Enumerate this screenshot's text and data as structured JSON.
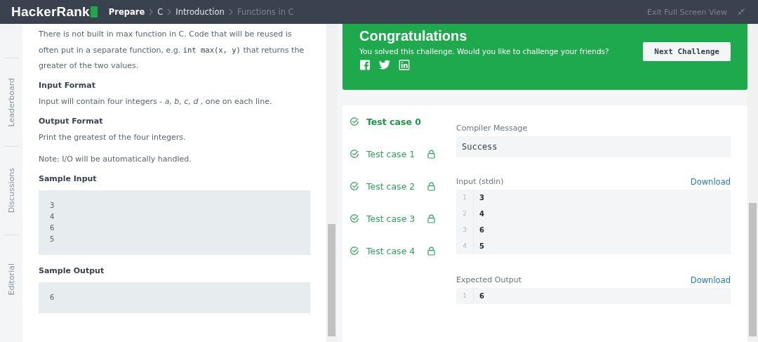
{
  "header": {
    "logo": "HackerRank",
    "breadcrumbs": [
      {
        "label": "Prepare",
        "current": false
      },
      {
        "label": "C",
        "current": false
      },
      {
        "label": "Introduction",
        "current": false
      },
      {
        "label": "Functions in C",
        "current": true
      }
    ],
    "exit_link": "Exit Full Screen View"
  },
  "side_tabs": [
    "Leaderboard",
    "Discussions",
    "Editorial"
  ],
  "problem": {
    "intro": [
      {
        "kind": "text",
        "text": "There is not built in max function in C. Code that will be reused is often put in a separate function, e.g. "
      },
      {
        "kind": "code",
        "text": "int max(x, y)"
      },
      {
        "kind": "text",
        "text": " that returns the greater of the two values."
      }
    ],
    "sections": [
      {
        "heading": "Input Format",
        "lines": [
          "Input will contain four integers - *a, b, c, d* , one on each line."
        ]
      },
      {
        "heading": "Output Format",
        "lines": [
          "Print the greatest of the four integers.",
          "Note: I/O will be automatically handled."
        ]
      },
      {
        "heading": "Sample Input",
        "code": [
          "3",
          "4",
          "6",
          "5"
        ]
      },
      {
        "heading": "Sample Output",
        "code": [
          "6"
        ]
      }
    ]
  },
  "banner": {
    "title": "Congratulations",
    "message": "You solved this challenge. Would you like to challenge your friends?",
    "button": "Next Challenge"
  },
  "test_cases": [
    {
      "label": "Test case 0",
      "selected": true,
      "locked": false
    },
    {
      "label": "Test case 1",
      "selected": false,
      "locked": true
    },
    {
      "label": "Test case 2",
      "selected": false,
      "locked": true
    },
    {
      "label": "Test case 3",
      "selected": false,
      "locked": true
    },
    {
      "label": "Test case 4",
      "selected": false,
      "locked": true
    }
  ],
  "compiler_message": {
    "label": "Compiler Message",
    "value": "Success"
  },
  "io": [
    {
      "label": "Input (stdin)",
      "download": "Download",
      "lines": [
        {
          "n": "1",
          "v": "3"
        },
        {
          "n": "2",
          "v": "4"
        },
        {
          "n": "3",
          "v": "6"
        },
        {
          "n": "4",
          "v": "5"
        }
      ]
    },
    {
      "label": "Expected Output",
      "download": "Download",
      "lines": [
        {
          "n": "1",
          "v": "6"
        }
      ]
    }
  ]
}
